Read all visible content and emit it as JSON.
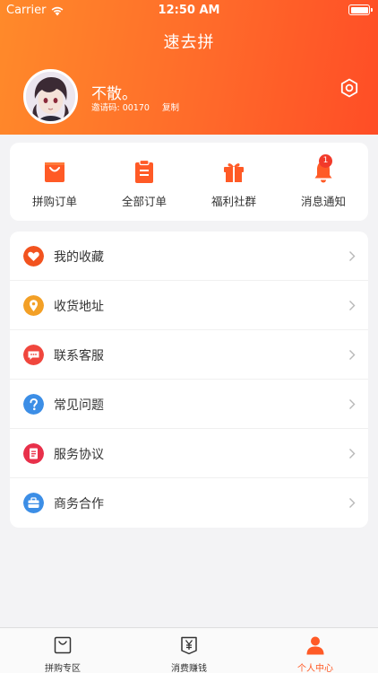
{
  "status_bar": {
    "carrier": "Carrier",
    "time": "12:50 AM"
  },
  "header": {
    "title": "速去拼"
  },
  "profile": {
    "name": "不散。",
    "invite_label": "邀请码: 00170",
    "copy_label": "复制"
  },
  "orders": [
    {
      "label": "拼购订单",
      "icon": "shopping-bag-icon"
    },
    {
      "label": "全部订单",
      "icon": "clipboard-icon"
    },
    {
      "label": "福利社群",
      "icon": "gift-icon"
    },
    {
      "label": "消息通知",
      "icon": "bell-icon",
      "badge": "1"
    }
  ],
  "menu": [
    {
      "label": "我的收藏",
      "icon": "heart-icon",
      "color": "#f2531f"
    },
    {
      "label": "收货地址",
      "icon": "location-pin-icon",
      "color": "#f3a026"
    },
    {
      "label": "联系客服",
      "icon": "chat-icon",
      "color": "#f0463d"
    },
    {
      "label": "常见问题",
      "icon": "question-icon",
      "color": "#3c8ee6"
    },
    {
      "label": "服务协议",
      "icon": "document-icon",
      "color": "#e8304a"
    },
    {
      "label": "商务合作",
      "icon": "briefcase-icon",
      "color": "#3c8ee6"
    }
  ],
  "tabs": [
    {
      "label": "拼购专区",
      "icon": "bag-tab-icon",
      "active": false
    },
    {
      "label": "消费赚钱",
      "icon": "yen-tab-icon",
      "active": false
    },
    {
      "label": "个人中心",
      "icon": "person-tab-icon",
      "active": true
    }
  ],
  "colors": {
    "accent": "#ff5a26",
    "header_start": "#ff8a2a",
    "header_end": "#ff4d26"
  }
}
